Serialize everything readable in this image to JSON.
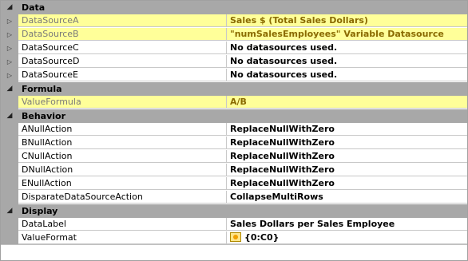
{
  "categories": [
    {
      "label": "Data",
      "rows": [
        {
          "name": "DataSourceA",
          "value": "Sales $ (Total Sales Dollars)",
          "highlight": true,
          "expandable": true
        },
        {
          "name": "DataSourceB",
          "value": "\"numSalesEmployees\" Variable Datasource",
          "highlight": true,
          "expandable": true
        },
        {
          "name": "DataSourceC",
          "value": "No datasources used.",
          "highlight": false,
          "expandable": true
        },
        {
          "name": "DataSourceD",
          "value": "No datasources used.",
          "highlight": false,
          "expandable": true
        },
        {
          "name": "DataSourceE",
          "value": "No datasources used.",
          "highlight": false,
          "expandable": true
        }
      ]
    },
    {
      "label": "Formula",
      "rows": [
        {
          "name": "ValueFormula",
          "value": "A/B",
          "highlight": true,
          "expandable": false
        }
      ]
    },
    {
      "label": "Behavior",
      "rows": [
        {
          "name": "ANullAction",
          "value": "ReplaceNullWithZero",
          "highlight": false,
          "expandable": false
        },
        {
          "name": "BNullAction",
          "value": "ReplaceNullWithZero",
          "highlight": false,
          "expandable": false
        },
        {
          "name": "CNullAction",
          "value": "ReplaceNullWithZero",
          "highlight": false,
          "expandable": false
        },
        {
          "name": "DNullAction",
          "value": "ReplaceNullWithZero",
          "highlight": false,
          "expandable": false
        },
        {
          "name": "ENullAction",
          "value": "ReplaceNullWithZero",
          "highlight": false,
          "expandable": false
        },
        {
          "name": "DisparateDataSourceAction",
          "value": "CollapseMultiRows",
          "highlight": false,
          "expandable": false
        }
      ]
    },
    {
      "label": "Display",
      "rows": [
        {
          "name": "DataLabel",
          "value": "Sales Dollars per Sales Employee",
          "highlight": false,
          "expandable": false
        },
        {
          "name": "ValueFormat",
          "value": "{0:C0}",
          "highlight": false,
          "expandable": false,
          "icon": "format-icon",
          "selected": true
        }
      ]
    }
  ],
  "colors": {
    "category_bg": "#a8a8a8",
    "highlight_bg": "#ffff99",
    "highlight_value_text": "#8a6a00"
  }
}
